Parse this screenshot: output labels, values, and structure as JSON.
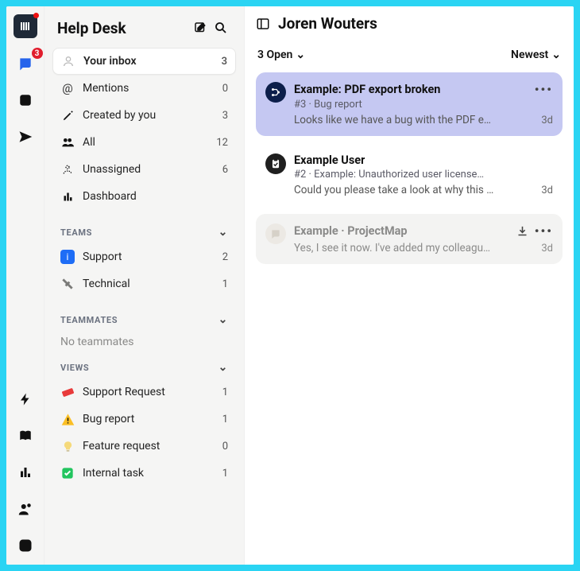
{
  "rail": {
    "inbox_badge": "3"
  },
  "sidebar": {
    "title": "Help Desk",
    "nav": [
      {
        "label": "Your inbox",
        "count": "3"
      },
      {
        "label": "Mentions",
        "count": "0"
      },
      {
        "label": "Created by you",
        "count": "3"
      },
      {
        "label": "All",
        "count": "12"
      },
      {
        "label": "Unassigned",
        "count": "6"
      },
      {
        "label": "Dashboard",
        "count": ""
      }
    ],
    "sections": {
      "teams": {
        "title": "TEAMS",
        "items": [
          {
            "label": "Support",
            "count": "2"
          },
          {
            "label": "Technical",
            "count": "1"
          }
        ]
      },
      "teammates": {
        "title": "TEAMMATES",
        "empty": "No teammates"
      },
      "views": {
        "title": "VIEWS",
        "items": [
          {
            "label": "Support Request",
            "count": "1"
          },
          {
            "label": "Bug report",
            "count": "1"
          },
          {
            "label": "Feature request",
            "count": "0"
          },
          {
            "label": "Internal task",
            "count": "1"
          }
        ]
      }
    }
  },
  "main": {
    "owner": "Joren Wouters",
    "filters": {
      "status": "3 Open",
      "sort": "Newest"
    },
    "tickets": [
      {
        "title": "Example: PDF export broken",
        "meta": "#3 · Bug report",
        "snippet": "Looks like we have a bug with the PDF e…",
        "time": "3d"
      },
      {
        "title": "Example User",
        "meta": "#2 · Example: Unauthorized user license…",
        "snippet": "Could you please take a look at why this …",
        "time": "3d"
      },
      {
        "title": "Example · ProjectMap",
        "meta": "",
        "snippet": "Yes, I see it now. I've added my colleagu…",
        "time": "3d"
      }
    ]
  }
}
